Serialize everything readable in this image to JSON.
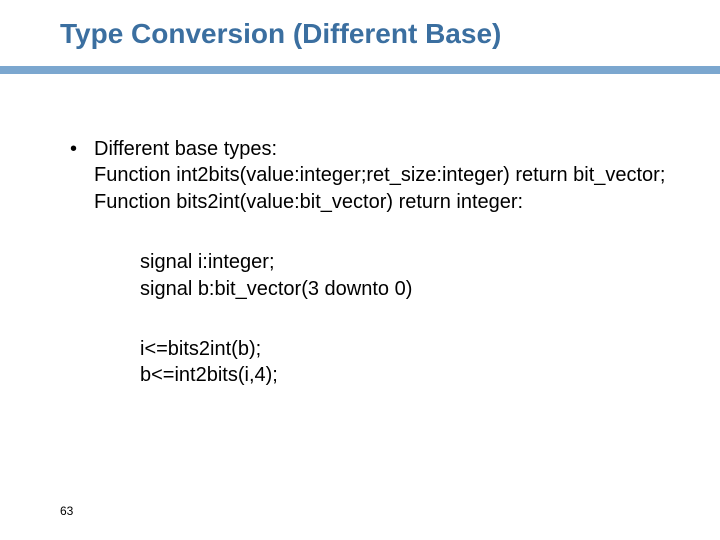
{
  "title": "Type Conversion (Different Base)",
  "bullet": {
    "heading": "Different base types:",
    "line1": "Function int2bits(value:integer;ret_size:integer) return bit_vector;",
    "line2": "Function bits2int(value:bit_vector) return integer:"
  },
  "signals": {
    "line1": "signal i:integer;",
    "line2": "signal b:bit_vector(3 downto 0)"
  },
  "assigns": {
    "line1": "i<=bits2int(b);",
    "line2": "b<=int2bits(i,4);"
  },
  "page_number": "63",
  "colors": {
    "title": "#3b6fa0",
    "rule": "#7ba7cf"
  }
}
